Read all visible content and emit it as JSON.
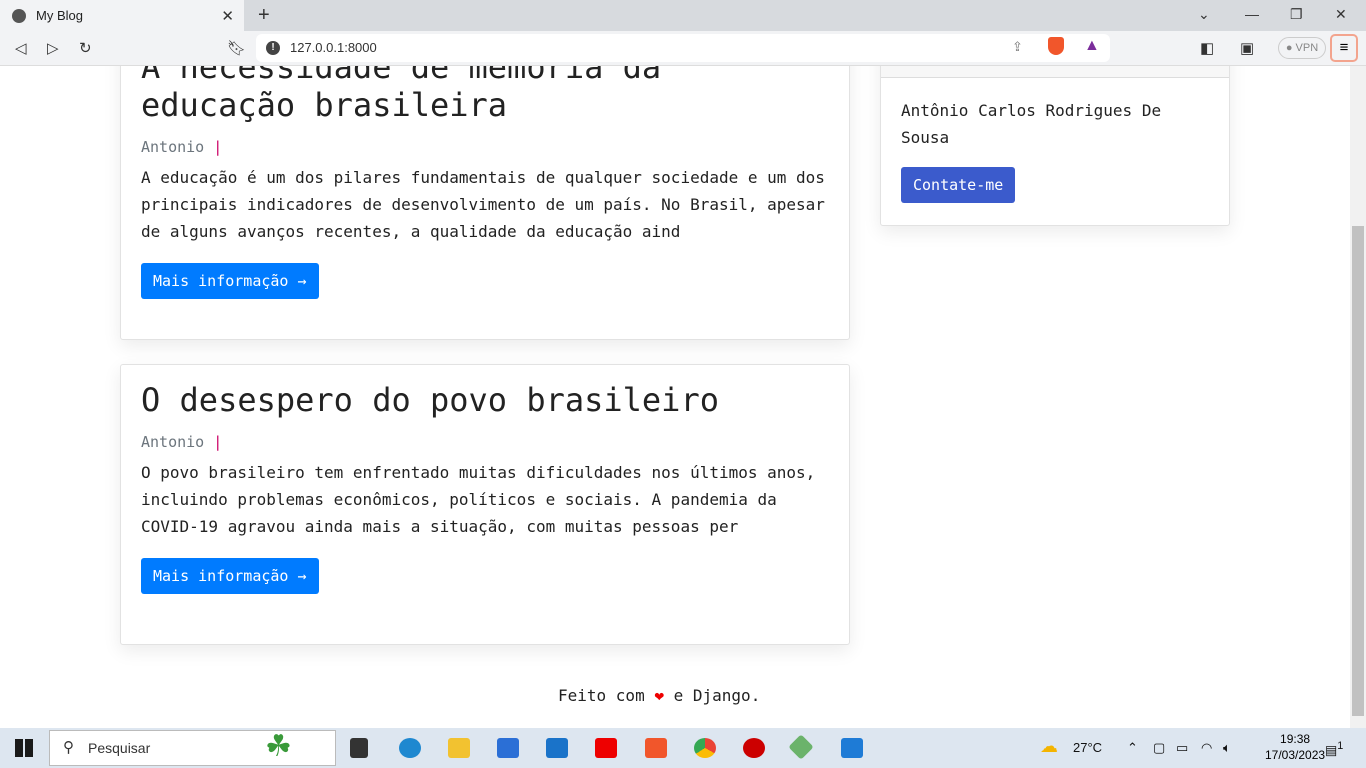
{
  "browser": {
    "tab_title": "My Blog",
    "url": "127.0.0.1:8000",
    "vpn": "VPN"
  },
  "posts": [
    {
      "title": "A necessidade de memória da educação brasileira",
      "author": "Antonio",
      "sep": "|",
      "excerpt": "A educação é um dos pilares fundamentais de qualquer sociedade e um dos principais indicadores de desenvolvimento de um país. No Brasil, apesar de alguns avanços recentes, a qualidade da educação aind",
      "button": "Mais informação →"
    },
    {
      "title": "O desespero do povo brasileiro",
      "author": "Antonio",
      "sep": "|",
      "excerpt": "O povo brasileiro tem enfrentado muitas dificuldades nos últimos anos, incluindo problemas econômicos, políticos e sociais. A pandemia da COVID-19 agravou ainda mais a situação, com muitas pessoas per",
      "button": "Mais informação →"
    }
  ],
  "sidebar": {
    "name": "Antônio Carlos Rodrigues De Sousa",
    "button": "Contate-me"
  },
  "footer": {
    "before": "Feito com",
    "heart": "❤",
    "after": "e Django."
  },
  "taskbar": {
    "search": "Pesquisar",
    "weather": "27°C",
    "time": "19:38",
    "date": "17/03/2023",
    "notifications": "1"
  }
}
